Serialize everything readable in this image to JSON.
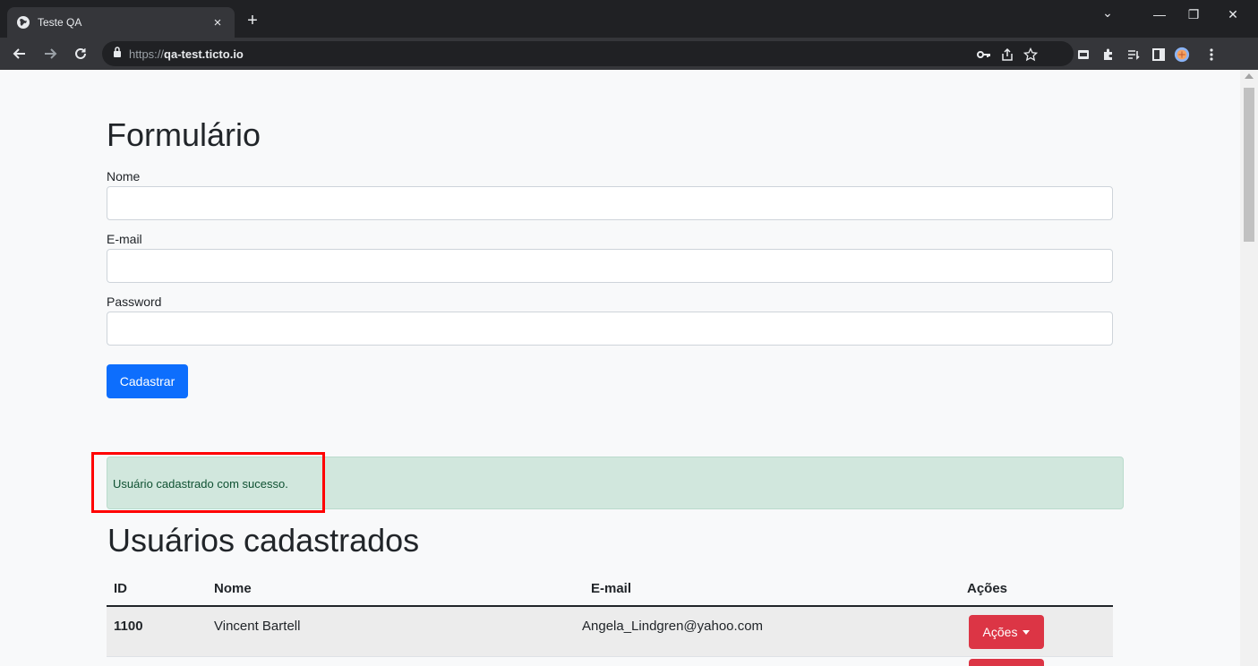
{
  "browser": {
    "tab_title": "Teste QA",
    "tab_close": "×",
    "new_tab": "+",
    "url_prefix": "https://",
    "url_host": "qa-test.ticto.io",
    "window_minimize": "—",
    "window_restore": "❐",
    "window_close": "✕",
    "tab_search": "⌄"
  },
  "form": {
    "title": "Formulário",
    "name_label": "Nome",
    "name_value": "",
    "email_label": "E-mail",
    "email_value": "",
    "password_label": "Password",
    "password_value": "",
    "submit_label": "Cadastrar"
  },
  "alert": {
    "message": "Usuário cadastrado com sucesso.",
    "color": "#d1e7dd"
  },
  "users": {
    "title": "Usuários cadastrados",
    "columns": [
      "ID",
      "Nome",
      "E-mail",
      "Ações"
    ],
    "rows": [
      {
        "id": "1100",
        "name": "Vincent Bartell",
        "email": "Angela_Lindgren@yahoo.com",
        "action_label": "Ações"
      }
    ]
  },
  "colors": {
    "primary": "#0d6efd",
    "danger": "#dc3545",
    "highlight": "#ff0000"
  }
}
